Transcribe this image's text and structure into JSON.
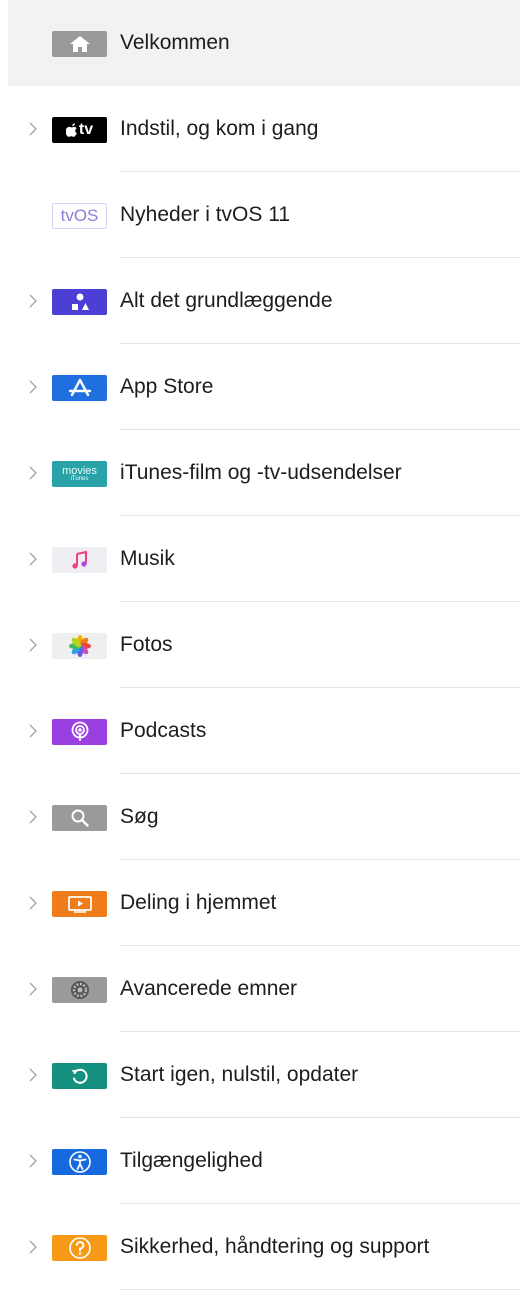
{
  "nav": {
    "items": [
      {
        "label": "Velkommen",
        "icon": "home-icon",
        "color": "#9a9a9a",
        "chevron": false,
        "selected": true
      },
      {
        "label": "Indstil, og kom i gang",
        "icon": "apple-tv-icon",
        "icon_text": "tv",
        "color": "#000000",
        "chevron": true
      },
      {
        "label": "Nyheder i tvOS 11",
        "icon": "tvos-icon",
        "icon_text": "tvOS",
        "color": "#ffffff",
        "chevron": false
      },
      {
        "label": "Alt det grundlæggende",
        "icon": "basics-icon",
        "color": "#4b3fd6",
        "chevron": true
      },
      {
        "label": "App Store",
        "icon": "app-store-icon",
        "color": "#1f6fe0",
        "chevron": true
      },
      {
        "label": "iTunes-film og -tv-udsendelser",
        "icon": "itunes-movies-icon",
        "icon_text": "movies",
        "icon_subtext": "iTunes",
        "color": "#2aa3a8",
        "chevron": true
      },
      {
        "label": "Musik",
        "icon": "music-icon",
        "color": "#eeeef3",
        "chevron": true
      },
      {
        "label": "Fotos",
        "icon": "photos-icon",
        "color": "#efefef",
        "chevron": true
      },
      {
        "label": "Podcasts",
        "icon": "podcasts-icon",
        "color": "#9a3fe0",
        "chevron": true
      },
      {
        "label": "Søg",
        "icon": "search-icon",
        "color": "#9a9a9a",
        "chevron": true
      },
      {
        "label": "Deling i hjemmet",
        "icon": "home-sharing-icon",
        "color": "#f07d1c",
        "chevron": true
      },
      {
        "label": "Avancerede emner",
        "icon": "settings-icon",
        "color": "#9a9a9a",
        "chevron": true
      },
      {
        "label": "Start igen, nulstil, opdater",
        "icon": "restart-icon",
        "color": "#14907e",
        "chevron": true
      },
      {
        "label": "Tilgængelighed",
        "icon": "accessibility-icon",
        "color": "#1769e0",
        "chevron": true
      },
      {
        "label": "Sikkerhed, håndtering og support",
        "icon": "help-icon",
        "color": "#f79a17",
        "chevron": true
      }
    ]
  }
}
